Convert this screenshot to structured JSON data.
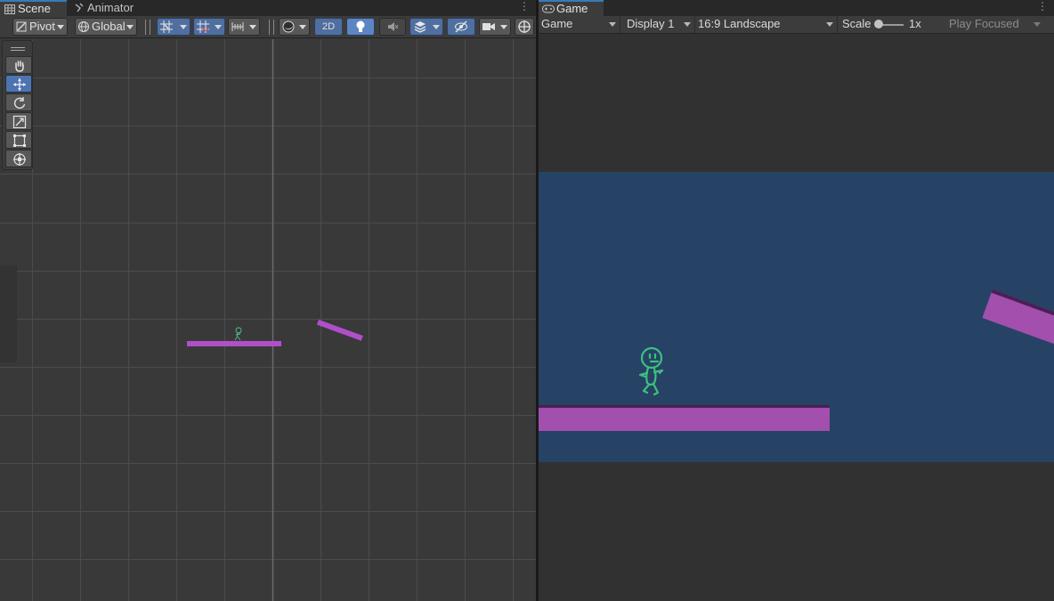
{
  "scene": {
    "tab_label": "Scene",
    "animator_tab_label": "Animator",
    "toolbar": {
      "pivot_label": "Pivot",
      "global_label": "Global",
      "mode_2d_label": "2D"
    },
    "tools": [
      "hand-tool",
      "move-tool",
      "rotate-tool",
      "scale-tool",
      "rect-tool",
      "transform-tool"
    ],
    "active_tool": "move-tool"
  },
  "game": {
    "tab_label": "Game",
    "toolbar": {
      "view_select": "Game",
      "display_select": "Display 1",
      "aspect_select": "16:9 Landscape",
      "scale_label": "Scale",
      "scale_value": "1x",
      "play_mode_select": "Play Focused"
    }
  },
  "colors": {
    "editor_bg": "#383838",
    "game_background": "#264365",
    "platform": "#a24fae",
    "character_outline": "#3fbf7f",
    "accent_blue": "#3a79bb"
  }
}
